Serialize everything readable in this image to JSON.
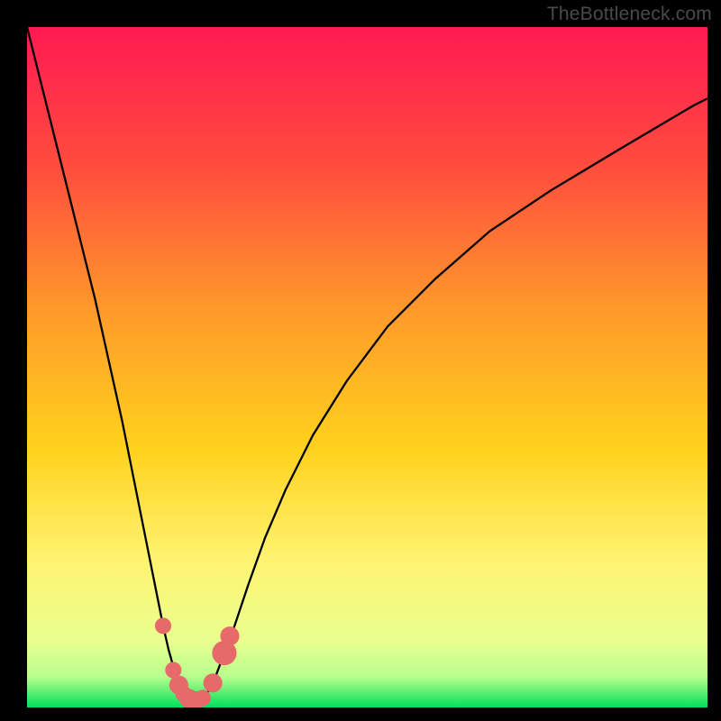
{
  "watermark": "TheBottleneck.com",
  "chart_data": {
    "type": "line",
    "title": "",
    "xlabel": "",
    "ylabel": "",
    "xlim": [
      0,
      100
    ],
    "ylim": [
      0,
      100
    ],
    "gradient_stops": [
      {
        "offset": 0,
        "color": "#ff1a52"
      },
      {
        "offset": 0.2,
        "color": "#ff4b3e"
      },
      {
        "offset": 0.42,
        "color": "#ff9b2a"
      },
      {
        "offset": 0.62,
        "color": "#ffd21c"
      },
      {
        "offset": 0.78,
        "color": "#fff370"
      },
      {
        "offset": 0.9,
        "color": "#eaff8e"
      },
      {
        "offset": 0.955,
        "color": "#b8ff8e"
      },
      {
        "offset": 1.0,
        "color": "#00e05a"
      }
    ],
    "series": [
      {
        "name": "bottleneck-curve",
        "x": [
          0.0,
          2,
          4,
          6,
          8,
          10,
          12,
          14,
          16,
          17,
          18,
          19,
          20,
          20.8,
          21.5,
          22.3,
          23.0,
          23.6,
          24.2,
          24.8,
          25.5,
          26.5,
          27.5,
          29,
          30.5,
          32.5,
          35,
          38,
          42,
          47,
          53,
          60,
          68,
          77,
          87,
          98,
          100
        ],
        "y": [
          100,
          92,
          84,
          76,
          68,
          60,
          51,
          42,
          32,
          27,
          22,
          17,
          12,
          8.5,
          6.0,
          4.0,
          2.6,
          1.7,
          1.2,
          1.0,
          1.2,
          2.2,
          4.0,
          8.0,
          12.0,
          18.0,
          25.0,
          32.0,
          40.0,
          48.0,
          56.0,
          63.0,
          70.0,
          76.0,
          82.0,
          88.5,
          89.5
        ]
      }
    ],
    "markers": [
      {
        "x": 20.0,
        "y": 12.0,
        "r": 1.2
      },
      {
        "x": 21.5,
        "y": 5.5,
        "r": 1.2
      },
      {
        "x": 22.3,
        "y": 3.3,
        "r": 1.4
      },
      {
        "x": 23.0,
        "y": 2.0,
        "r": 1.2
      },
      {
        "x": 23.8,
        "y": 1.3,
        "r": 1.4
      },
      {
        "x": 24.8,
        "y": 1.0,
        "r": 1.4
      },
      {
        "x": 25.8,
        "y": 1.4,
        "r": 1.2
      },
      {
        "x": 27.3,
        "y": 3.6,
        "r": 1.4
      },
      {
        "x": 29.0,
        "y": 8.0,
        "r": 1.8
      },
      {
        "x": 29.8,
        "y": 10.5,
        "r": 1.4
      }
    ],
    "marker_color": "#e66a6a",
    "curve_color": "#000000",
    "curve_width": 0.35
  }
}
